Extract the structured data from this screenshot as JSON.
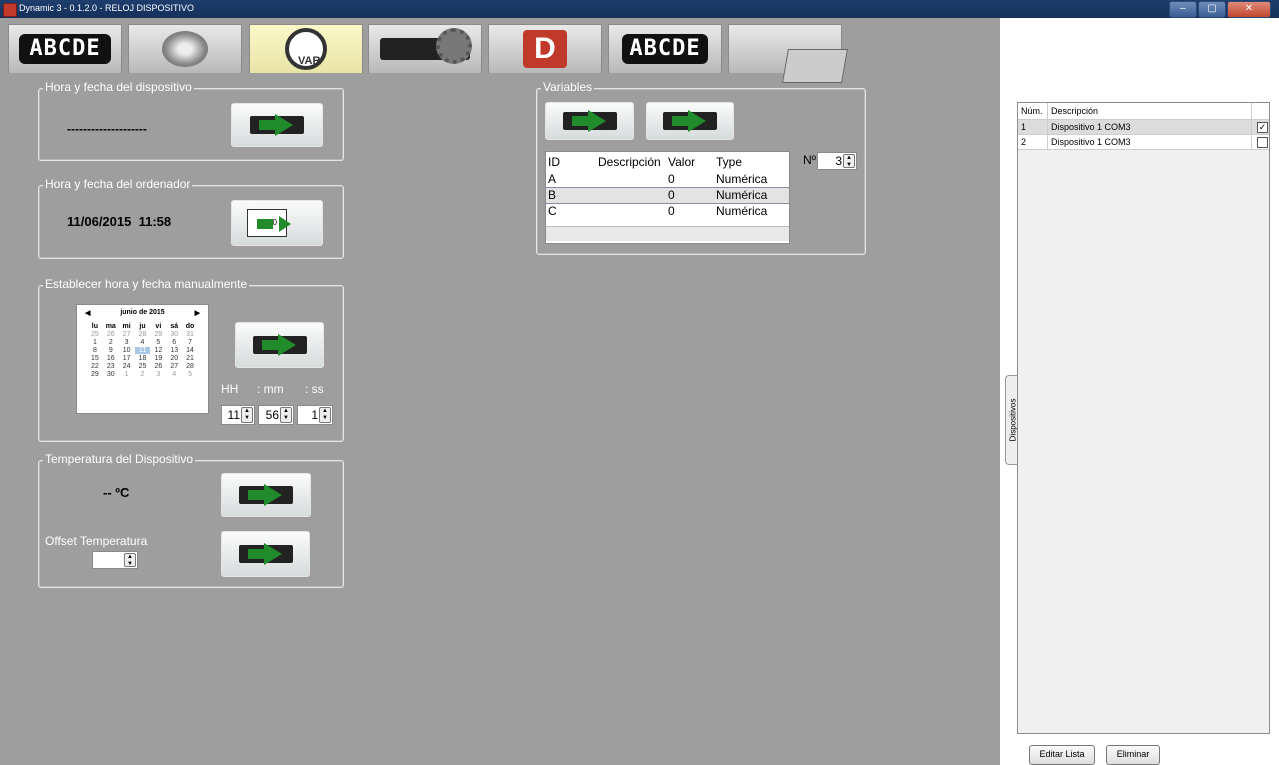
{
  "window": {
    "title": "Dynamic 3 - 0.1.2.0 - RELOJ DISPOSITIVO",
    "controls": [
      "minimize",
      "maximize",
      "close"
    ]
  },
  "toolbar": {
    "tabs": [
      {
        "name": "led-text-tab",
        "icon": "led-sign-icon",
        "label": "ABCDE"
      },
      {
        "name": "devices-tab",
        "icon": "disc-icon"
      },
      {
        "name": "clock-tab",
        "icon": "clock-var-icon",
        "label": "VAR",
        "active": true
      },
      {
        "name": "config-tab",
        "icon": "device-gear-icon"
      },
      {
        "name": "dynamic-tab",
        "icon": "d-logo-icon",
        "label": "D"
      },
      {
        "name": "edit-tab",
        "icon": "led-edit-icon",
        "label": "ABCDE"
      },
      {
        "name": "serial-tab",
        "icon": "serial-port-icon"
      }
    ]
  },
  "device_time": {
    "legend": "Hora y fecha del dispositivo",
    "value": "--------------------"
  },
  "computer_time": {
    "legend": "Hora y fecha del ordenador",
    "value": "11/06/2015  11:58",
    "monitor_text": "12:00"
  },
  "manual_time": {
    "legend": "Establecer hora y fecha manualmente",
    "calendar": {
      "month": "junio de 2015",
      "prev": "◀",
      "next": "▶",
      "weekdays": [
        "lu",
        "ma",
        "mi",
        "ju",
        "vi",
        "sá",
        "do"
      ],
      "weeks": [
        [
          "25",
          "26",
          "27",
          "28",
          "29",
          "30",
          "31"
        ],
        [
          "1",
          "2",
          "3",
          "4",
          "5",
          "6",
          "7"
        ],
        [
          "8",
          "9",
          "10",
          "11",
          "12",
          "13",
          "14"
        ],
        [
          "15",
          "16",
          "17",
          "18",
          "19",
          "20",
          "21"
        ],
        [
          "22",
          "23",
          "24",
          "25",
          "26",
          "27",
          "28"
        ],
        [
          "29",
          "30",
          "1",
          "2",
          "3",
          "4",
          "5"
        ]
      ],
      "selected": "11"
    },
    "time_label_hh": "HH",
    "time_label_mm": ": mm",
    "time_label_ss": ": ss",
    "hh": "11",
    "mm": "56",
    "ss": "1"
  },
  "temperature": {
    "legend": "Temperatura del Dispositivo",
    "value": "-- ºC",
    "offset_label": "Offset Temperatura",
    "offset_value": ""
  },
  "variables": {
    "legend": "Variables",
    "count_label": "Nº",
    "count": "3",
    "columns": [
      "ID",
      "Descripción",
      "Valor",
      "Type"
    ],
    "rows": [
      {
        "id": "A",
        "desc": "",
        "value": "0",
        "type": "Numérica"
      },
      {
        "id": "B",
        "desc": "",
        "value": "0",
        "type": "Numérica"
      },
      {
        "id": "C",
        "desc": "",
        "value": "0",
        "type": "Numérica"
      }
    ]
  },
  "devices_panel": {
    "tab_label": "Dispositivos",
    "columns": [
      "Núm.",
      "Descripción"
    ],
    "rows": [
      {
        "num": "1",
        "desc": "Dispositivo 1 COM3",
        "checked": true
      },
      {
        "num": "2",
        "desc": "Dispositivo 1 COM3",
        "checked": false
      }
    ],
    "edit_label": "Editar Lista",
    "delete_label": "Eliminar"
  }
}
